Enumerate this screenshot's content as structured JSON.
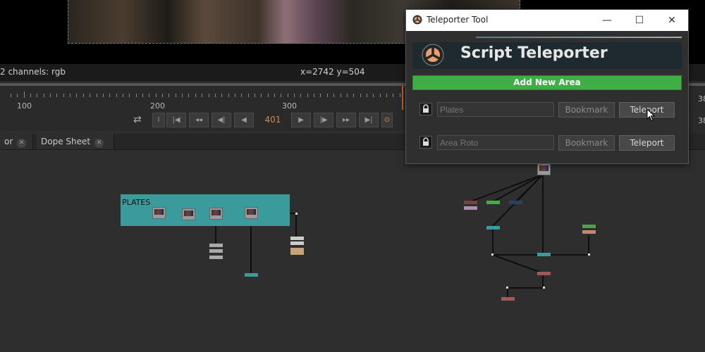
{
  "viewer": {
    "channels": "2 channels: rgb",
    "coords": "x=2742 y=504"
  },
  "timeline": {
    "tick_labels": [
      "100",
      "200",
      "300"
    ],
    "current_frame": "401",
    "edge_labels": [
      "38",
      "38"
    ]
  },
  "transport": {
    "buttons": [
      "loop-icon",
      "in-point-icon",
      "first-frame-icon",
      "prev-keyframe-icon",
      "step-back-icon",
      "play-backward-icon",
      "play-forward-icon",
      "step-forward-icon",
      "next-keyframe-icon",
      "last-frame-icon",
      "out-point-icon"
    ]
  },
  "tabs": [
    {
      "label": "or"
    },
    {
      "label": "Dope Sheet"
    }
  ],
  "node_graph": {
    "backdrop_label": "PLATES"
  },
  "dialog": {
    "title": "Teleporter Tool",
    "banner_title": "Script Teleporter",
    "add_area_label": "Add New Area",
    "areas": [
      {
        "placeholder": "Plates",
        "bookmark_label": "Bookmark",
        "teleport_label": "Teleport"
      },
      {
        "placeholder": "Area Roto",
        "bookmark_label": "Bookmark",
        "teleport_label": "Teleport"
      }
    ],
    "window_buttons": [
      "minimize-icon",
      "maximize-icon",
      "close-icon"
    ]
  },
  "colors": {
    "accent_green": "#3fae45",
    "backdrop_teal": "#3a9a9c",
    "frame_orange": "#d08a50"
  }
}
